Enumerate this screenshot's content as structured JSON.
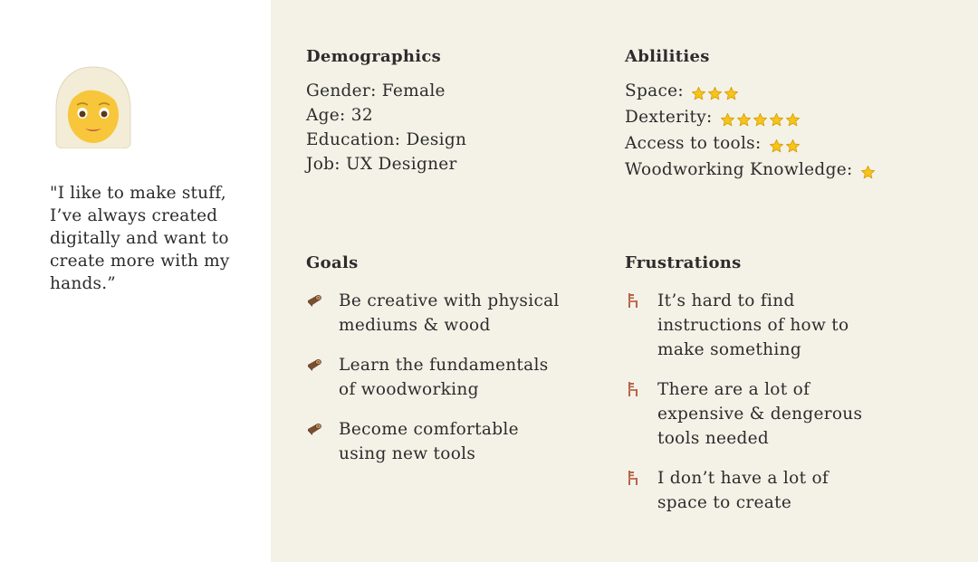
{
  "persona": {
    "quote": "\"I like to make stuff, I’ve always created digitally and want to create more with my hands.”"
  },
  "demographics": {
    "title": "Demographics",
    "lines": [
      "Gender: Female",
      "Age: 32",
      "Education: Design",
      "Job: UX Designer"
    ]
  },
  "abilities": {
    "title": "Ablilities",
    "items": [
      {
        "label": "Space:",
        "stars": 3
      },
      {
        "label": "Dexterity:",
        "stars": 5
      },
      {
        "label": "Access to tools:",
        "stars": 2
      },
      {
        "label": "Woodworking Knowledge:",
        "stars": 1
      }
    ]
  },
  "goals": {
    "title": "Goals",
    "icon": "wood-log-icon",
    "items": [
      "Be creative with physical mediums & wood",
      "Learn the fundamentals of woodworking",
      "Become comfortable using new tools"
    ]
  },
  "frustrations": {
    "title": "Frustrations",
    "icon": "chair-icon",
    "items": [
      "It’s hard to find instructions of how to make something",
      "There are a lot of expensive & dengerous tools needed",
      "I don’t have a lot of space to create"
    ]
  },
  "colors": {
    "panel_bg": "#f4f2e7",
    "star": "#f5c518",
    "text": "#2c2c2c"
  }
}
